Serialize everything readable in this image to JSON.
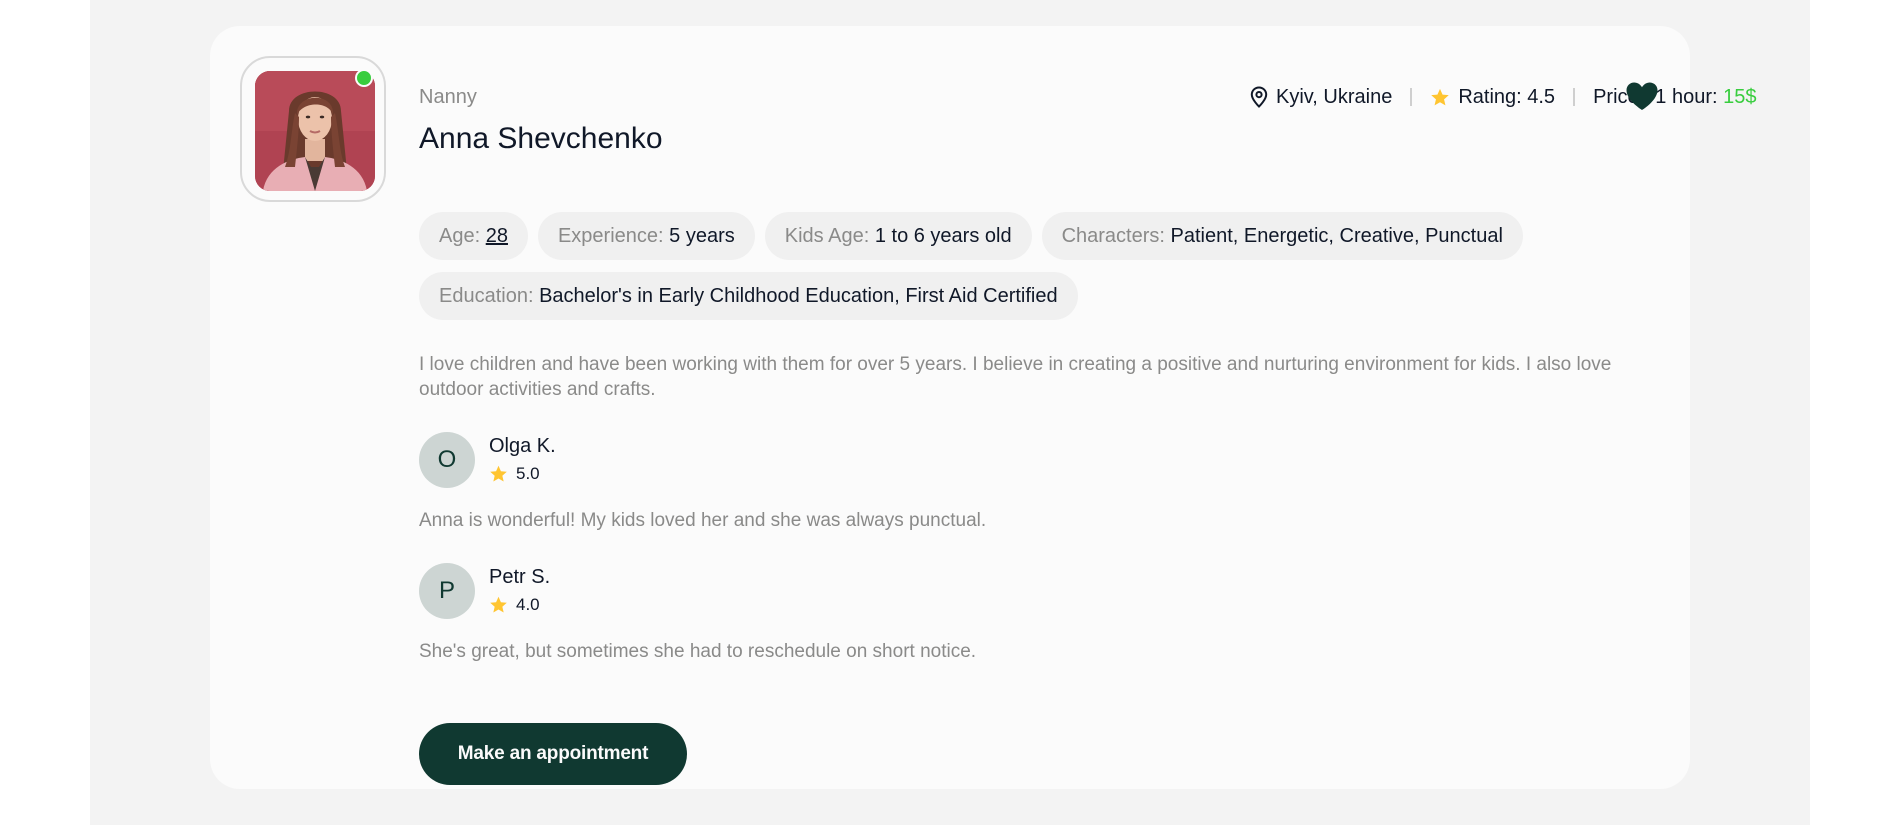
{
  "nanny": {
    "role": "Nanny",
    "name": "Anna Shevchenko",
    "online": true,
    "location": "Kyiv, Ukraine",
    "rating_label": "Rating: 4.5",
    "price_label": "Price / 1 hour: ",
    "price_value": "15$",
    "favorite": true
  },
  "chips": {
    "age_key": "Age: ",
    "age_val": "28",
    "exp_key": "Experience: ",
    "exp_val": "5 years",
    "kids_key": "Kids Age: ",
    "kids_val": "1 to 6 years old",
    "char_key": "Characters: ",
    "char_val": "Patient, Energetic, Creative, Punctual",
    "edu_key": "Education: ",
    "edu_val": "Bachelor's in Early Childhood Education, First Aid Certified"
  },
  "about": "I love children and have been working with them for over 5 years. I believe in creating a positive and nurturing environment for kids. I also love outdoor activities and crafts.",
  "reviews": [
    {
      "initial": "O",
      "name": "Olga K.",
      "rating": "5.0",
      "text": "Anna is wonderful! My kids loved her and she was always punctual."
    },
    {
      "initial": "P",
      "name": "Petr S.",
      "rating": "4.0",
      "text": "She's great, but sometimes she had to reschedule on short notice."
    }
  ],
  "cta": "Make an appointment",
  "colors": {
    "accent": "#103931",
    "price": "#38cd3e",
    "star": "#ffc531",
    "muted": "#8a8a89"
  }
}
